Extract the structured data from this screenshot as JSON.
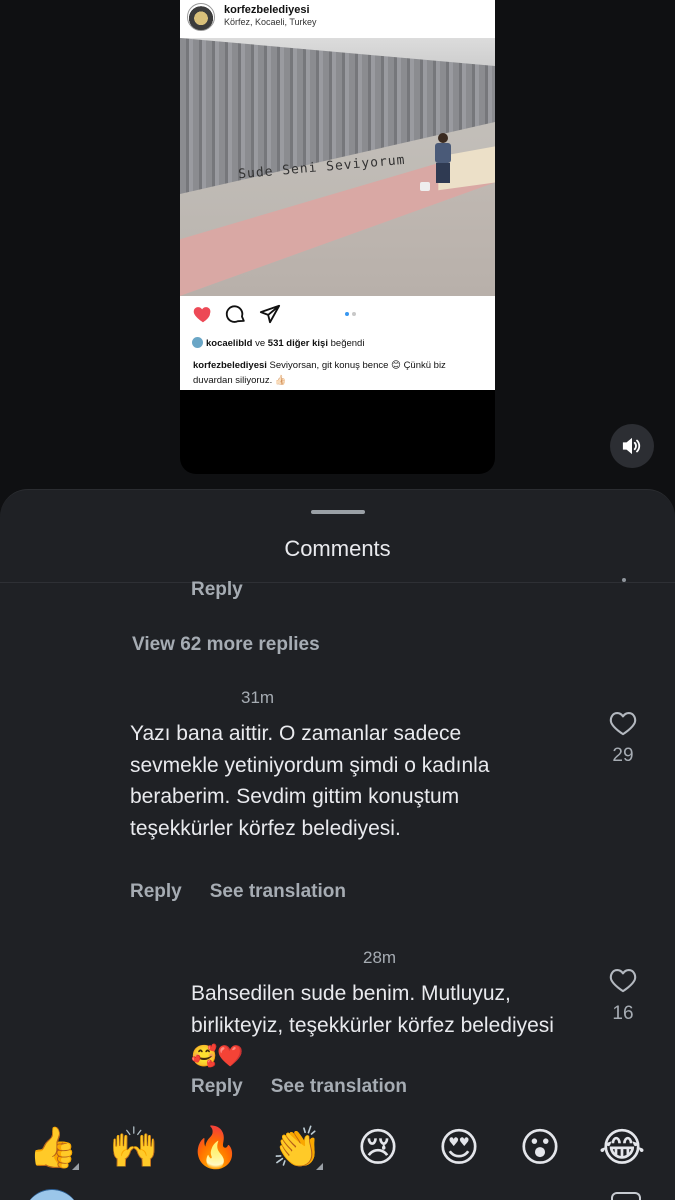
{
  "post": {
    "username": "korfezbelediyesi",
    "location": "Körfez, Kocaeli, Turkey",
    "photo_text": "Sude Seni Seviyorum",
    "likes_user": "kocaelibld",
    "likes_mid": " ve ",
    "likes_others": "531 diğer kişi",
    "likes_suffix": " beğendi",
    "caption_user": "korfezbelediyesi",
    "caption_text": " Seviyorsan, git konuş bence 😊 Çünkü biz duvardan siliyoruz. 👍🏻"
  },
  "sheet": {
    "title": "Comments",
    "prev_reply_label": "Reply",
    "view_more": "View 62 more replies"
  },
  "comments": [
    {
      "time": "31m",
      "text": "Yazı bana aittir. O zamanlar sadece sevmekle yetiniyordum şimdi o kadınla beraberim. Sevdim gittim konuştum teşekkürler körfez belediyesi.",
      "reply_label": "Reply",
      "translate_label": "See translation",
      "likes": "29"
    },
    {
      "time": "28m",
      "text": "Bahsedilen sude benim. Mutluyuz, birlikteyiz, teşekkürler körfez belediyesi 🥰❤️",
      "reply_label": "Reply",
      "translate_label": "See translation",
      "likes": "16"
    }
  ],
  "reactions": [
    "👍",
    "🙌",
    "🔥",
    "👏",
    "😢",
    "😍",
    "😮",
    "😂"
  ],
  "colors": {
    "sheet_bg": "#1f2125",
    "muted_text": "#a6acb3",
    "like_red": "#ed4956",
    "carousel_active": "#3897f0"
  }
}
